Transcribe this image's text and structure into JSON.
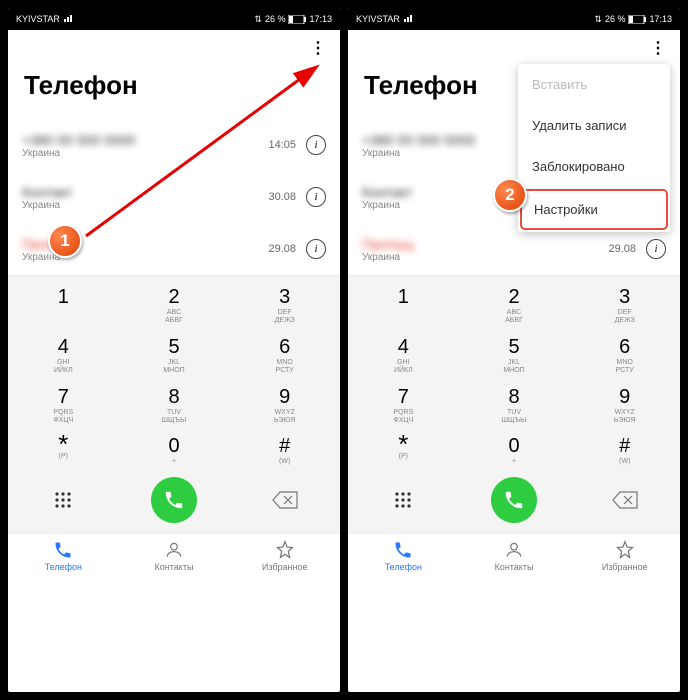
{
  "status": {
    "carrier": "KYIVSTAR",
    "battery": "26 %",
    "time": "17:13"
  },
  "title": "Телефон",
  "calls": [
    {
      "country": "Украина",
      "time": "14:05",
      "red": false
    },
    {
      "country": "Украина",
      "time": "30.08",
      "red": false
    },
    {
      "country": "Украина",
      "time": "29.08",
      "red": true
    }
  ],
  "dialpad": [
    [
      {
        "n": "1",
        "a": "",
        "b": ""
      },
      {
        "n": "2",
        "a": "ABC",
        "b": "АБВГ"
      },
      {
        "n": "3",
        "a": "DEF",
        "b": "ДЕЖЗ"
      }
    ],
    [
      {
        "n": "4",
        "a": "GHI",
        "b": "ИЙКЛ"
      },
      {
        "n": "5",
        "a": "JKL",
        "b": "МНОП"
      },
      {
        "n": "6",
        "a": "MNO",
        "b": "РСТУ"
      }
    ],
    [
      {
        "n": "7",
        "a": "PQRS",
        "b": "ФХЦЧ"
      },
      {
        "n": "8",
        "a": "TUV",
        "b": "ШЩЪЫ"
      },
      {
        "n": "9",
        "a": "WXYZ",
        "b": "ЬЭЮЯ"
      }
    ],
    [
      {
        "n": "*",
        "a": "(P)",
        "b": ""
      },
      {
        "n": "0",
        "a": "+",
        "b": ""
      },
      {
        "n": "#",
        "a": "(W)",
        "b": ""
      }
    ]
  ],
  "nav": {
    "phone": "Телефон",
    "contacts": "Контакты",
    "favorites": "Избранное"
  },
  "dropdown": {
    "paste": "Вставить",
    "delete": "Удалить записи",
    "blocked": "Заблокировано",
    "settings": "Настройки"
  },
  "markers": {
    "one": "1",
    "two": "2"
  }
}
